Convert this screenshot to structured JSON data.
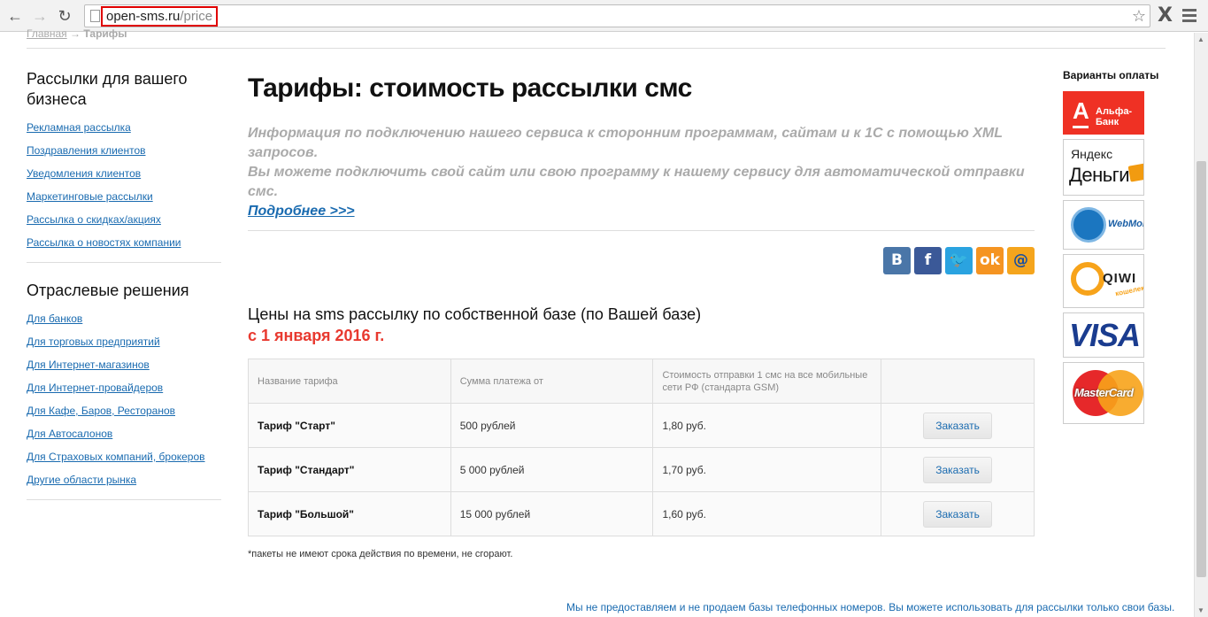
{
  "browser": {
    "url_host": "open-sms.ru",
    "url_path": "/price"
  },
  "breadcrumb": {
    "home": "Главная",
    "separator": "→",
    "current": "Тарифы"
  },
  "sidebar": {
    "section1_title": "Рассылки для вашего бизнеса",
    "section1_items": [
      "Рекламная рассылка",
      "Поздравления клиентов",
      "Уведомления клиентов",
      "Маркетинговые рассылки",
      "Рассылка о скидках/акциях",
      "Рассылка о новостях компании"
    ],
    "section2_title": "Отраслевые решения",
    "section2_items": [
      "Для банков",
      "Для торговых предприятий",
      "Для Интернет-магазинов",
      "Для Интернет-провайдеров",
      "Для Кафе, Баров, Ресторанов",
      "Для Автосалонов",
      "Для Страховых компаний, брокеров",
      "Другие области рынка"
    ]
  },
  "main": {
    "title": "Тарифы: стоимость рассылки смс",
    "info_line1": "Информация по подключению нашего сервиса к сторонним программам, сайтам и к 1С с помощью XML запросов.",
    "info_line2": "Вы можете подключить свой сайт или свою программу к нашему сервису для автоматической отправки смс.",
    "more_link": "Подробнее >>>",
    "subtitle": "Цены на sms рассылку по собственной базе (по Вашей базе)",
    "date": "с 1 января 2016 г.",
    "table": {
      "headers": [
        "Название тарифа",
        "Сумма платежа от",
        "Стоимость отправки 1 смс на все мобильные сети РФ (стандарта GSM)",
        ""
      ],
      "rows": [
        {
          "name": "Тариф \"Старт\"",
          "amount": "500 рублей",
          "price": "1,80 руб.",
          "button": "Заказать"
        },
        {
          "name": "Тариф \"Стандарт\"",
          "amount": "5 000 рублей",
          "price": "1,70 руб.",
          "button": "Заказать"
        },
        {
          "name": "Тариф \"Большой\"",
          "amount": "15 000 рублей",
          "price": "1,60 руб.",
          "button": "Заказать"
        }
      ]
    },
    "note": "*пакеты не имеют срока действия по времени, не сгорают."
  },
  "payments": {
    "title": "Варианты оплаты",
    "alfa_letter": "А",
    "alfa": "Альфа-Банк",
    "yandex_line1": "Яндекс",
    "yandex_line2": "Деньги",
    "webmoney": "WebMoney",
    "qiwi": "QIWI",
    "qiwi_sub": "кошелек",
    "visa": "VISA",
    "mastercard": "MasterCard"
  },
  "footer": "Мы не предоставляем и не продаем базы телефонных номеров. Вы можете использовать для рассылки только свои базы."
}
